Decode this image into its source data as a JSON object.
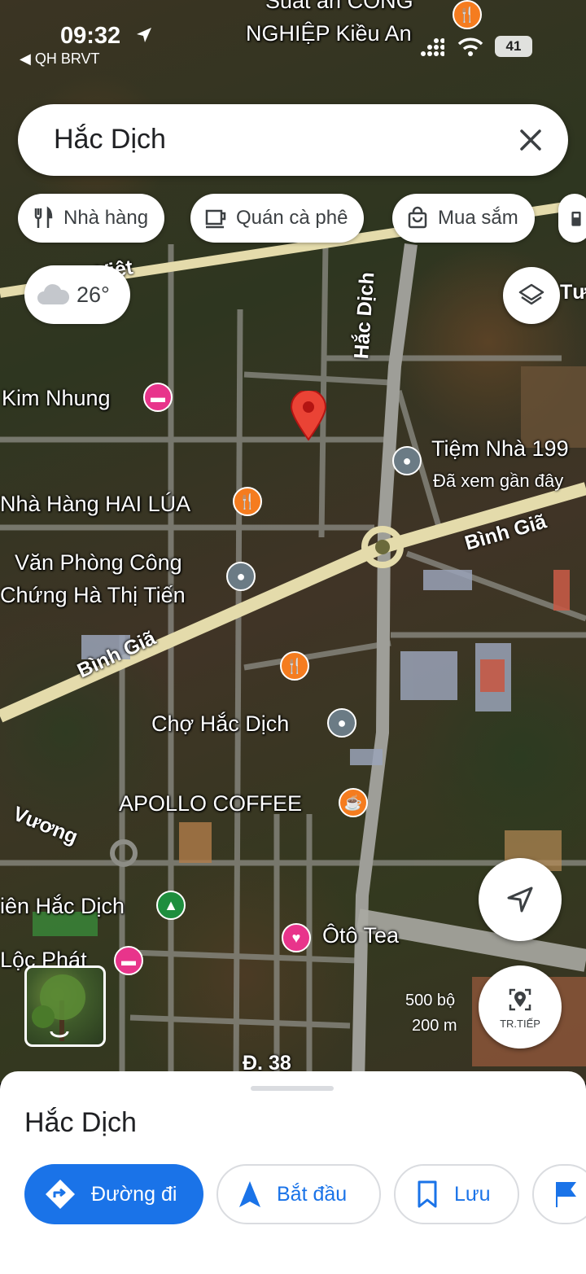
{
  "status_bar": {
    "time": "09:32",
    "carrier": "◀ QH BRVT",
    "battery": "41"
  },
  "search": {
    "query": "Hắc Dịch"
  },
  "chips": [
    {
      "label": "Nhà hàng",
      "icon": "fork-knife-icon"
    },
    {
      "label": "Quán cà phê",
      "icon": "coffee-cup-icon"
    },
    {
      "label": "Mua sắm",
      "icon": "shopping-bag-icon"
    }
  ],
  "weather": {
    "temperature": "26°",
    "icon": "cloud-icon"
  },
  "map": {
    "road_labels": {
      "hac_dich": "Hắc Dịch",
      "binh_gia_upper": "Bình Giã",
      "binh_gia_lower": "Bình Giã",
      "vuong": "Vương",
      "vuong_prefix": "...",
      "d38": "Đ. 38",
      "viet": "Việt",
      "tu": "Tư"
    },
    "places": {
      "top_partial": "NGHIỆP Kiều An",
      "top_partial_cut": "Suất ăn CÔNG",
      "kim_nhung": "Kim Nhung",
      "tiem_nha": "Tiệm Nhà 199",
      "tiem_nha_sub": "Đã xem gần đây",
      "hai_lua": "Nhà Hàng HAI LÚA",
      "van_phong_1": "Văn Phòng Công",
      "van_phong_2": "Chứng Hà Thị Tiến",
      "cho_hac_dich": "Chợ Hắc Dịch",
      "apollo": "APOLLO COFFEE",
      "park": "iên Hắc Dịch",
      "oto_tea": "Ôtô Tea",
      "loc_phat": "Lộc Phát"
    },
    "scale": {
      "feet": "500 bộ",
      "meters": "200 m"
    },
    "accent_colors": {
      "restaurant": "#f57c1f",
      "hotel": "#e8348b",
      "generic": "#6b7b85",
      "park": "#1e8e3e",
      "pin": "#ea4335"
    }
  },
  "controls": {
    "next_label": "TR.TIẾP"
  },
  "sheet": {
    "title": "Hắc Dịch",
    "actions": [
      {
        "label": "Đường đi",
        "icon": "directions-icon"
      },
      {
        "label": "Bắt đầu",
        "icon": "navigation-arrow-icon"
      },
      {
        "label": "Lưu",
        "icon": "bookmark-icon"
      },
      {
        "label": "",
        "icon": "flag-icon"
      }
    ],
    "primary_color": "#1a73e8"
  }
}
